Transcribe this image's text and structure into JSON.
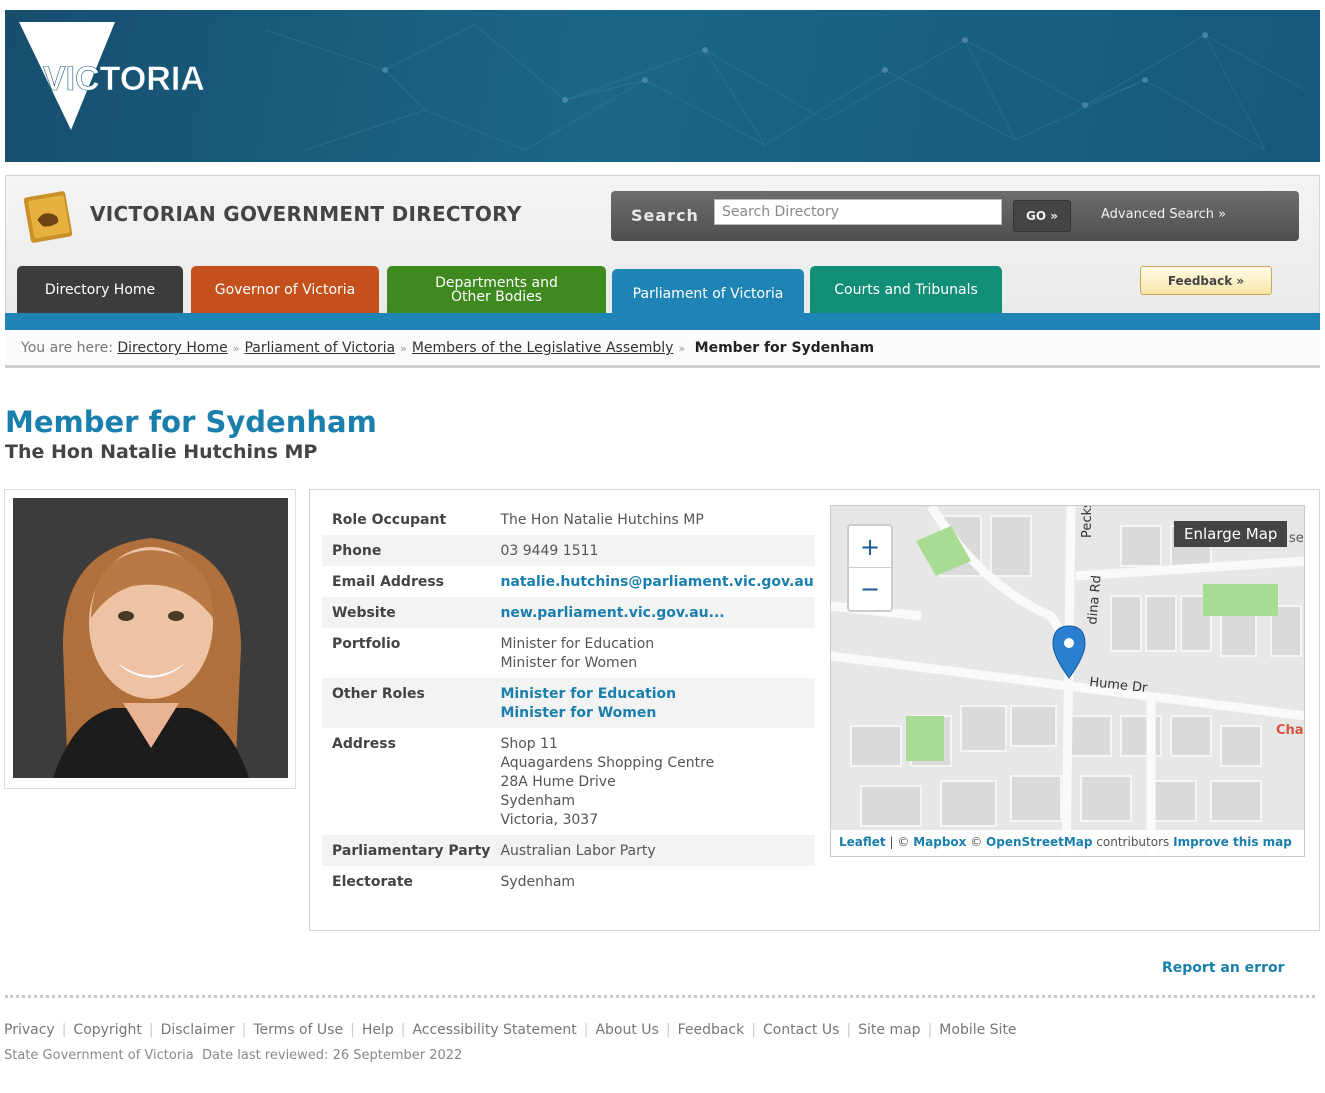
{
  "brand": {
    "logo_text": "VICTORIA"
  },
  "directory": {
    "title": "VICTORIAN GOVERNMENT DIRECTORY",
    "search_label": "Search",
    "search_placeholder": "Search Directory",
    "go_label": "GO »",
    "advanced_search": "Advanced Search »",
    "feedback": "Feedback »"
  },
  "tabs": [
    {
      "label": "Directory Home",
      "color": "#3c3c3c"
    },
    {
      "label": "Governor of Victoria",
      "color": "#c4511c"
    },
    {
      "label": "Departments and Other Bodies",
      "color": "#3f8a1f"
    },
    {
      "label": "Parliament of Victoria",
      "color": "#1e84b5",
      "active": true
    },
    {
      "label": "Courts and Tribunals",
      "color": "#118e76"
    }
  ],
  "breadcrumb": {
    "prefix": "You are here:",
    "items": [
      "Directory Home",
      "Parliament of Victoria",
      "Members of the Legislative Assembly"
    ],
    "current": "Member for Sydenham"
  },
  "page": {
    "title": "Member for Sydenham",
    "subtitle": "The Hon Natalie Hutchins MP"
  },
  "details": {
    "role_occupant": {
      "label": "Role Occupant",
      "value": "The Hon Natalie Hutchins MP"
    },
    "phone": {
      "label": "Phone",
      "value": "03 9449 1511"
    },
    "email": {
      "label": "Email Address",
      "value": "natalie.hutchins@parliament.vic.gov.au"
    },
    "website": {
      "label": "Website",
      "value": "new.parliament.vic.gov.au..."
    },
    "portfolio": {
      "label": "Portfolio",
      "values": [
        "Minister for Education",
        "Minister for Women"
      ]
    },
    "other_roles": {
      "label": "Other Roles",
      "values": [
        "Minister for Education",
        "Minister for Women"
      ]
    },
    "address": {
      "label": "Address",
      "lines": [
        "Shop 11",
        "Aquagardens Shopping Centre",
        "28A Hume Drive",
        "Sydenham",
        "Victoria, 3037"
      ]
    },
    "party": {
      "label": "Parliamentary Party",
      "value": "Australian Labor Party"
    },
    "electorate": {
      "label": "Electorate",
      "value": "Sydenham"
    }
  },
  "map": {
    "zoom_in": "+",
    "zoom_out": "−",
    "enlarge": "Enlarge Map",
    "street_labels": [
      "Hume Dr",
      "Pecks",
      "dina Rd",
      "Cha",
      "se"
    ],
    "attribution": {
      "leaflet": "Leaflet",
      "sep": "|",
      "copy1": "©",
      "mapbox": "Mapbox",
      "copy2": "©",
      "osm": "OpenStreetMap",
      "contributors": "contributors",
      "improve": "Improve this map"
    }
  },
  "report_error": "Report an error",
  "footer": {
    "links": [
      "Privacy",
      "Copyright",
      "Disclaimer",
      "Terms of Use",
      "Help",
      "Accessibility Statement",
      "About Us",
      "Feedback",
      "Contact Us",
      "Site map",
      "Mobile Site"
    ],
    "owner": "State Government of Victoria",
    "reviewed": "Date last reviewed: 26 September 2022"
  }
}
